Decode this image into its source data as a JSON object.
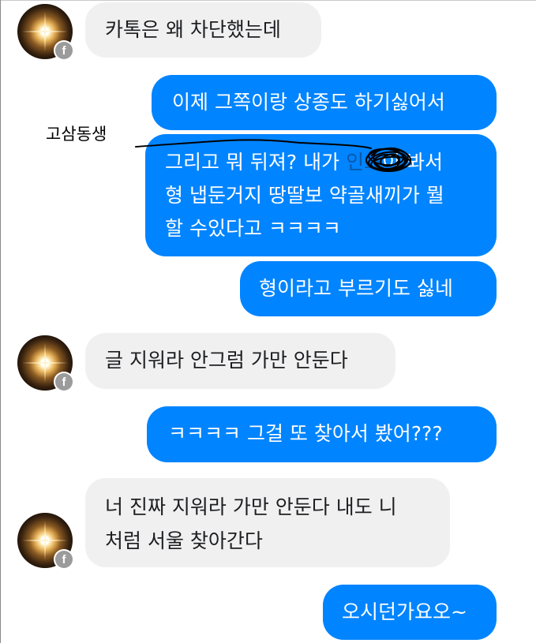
{
  "messages": [
    {
      "side": "in",
      "text": "카톡은 왜 차단했는데"
    },
    {
      "side": "out",
      "text": "이제 그쪽이랑 상종도 하기싫어서"
    },
    {
      "side": "out",
      "line1": "그리고 뭐 뒤져? 내가 ",
      "line1_hidden": "인스",
      "line1_tail": "이 봐서",
      "line2": "형 냅둔거지 땅딸보 약골새끼가 뭘",
      "line3": "할 수있다고 ㅋㅋㅋㅋ"
    },
    {
      "side": "out",
      "text": "형이라고 부르기도 싫네"
    },
    {
      "side": "in",
      "text": "글 지워라 안그럼 가만 안둔다"
    },
    {
      "side": "out",
      "text": "ㅋㅋㅋㅋ 그걸 또 찾아서 봤어???"
    },
    {
      "side": "in",
      "line1": "너 진짜 지워라 가만 안둔다 내도 니",
      "line2": "처럼 서울 찾아간다"
    },
    {
      "side": "out",
      "text": "오시던가요오~"
    }
  ],
  "annotation": {
    "label": "고삼동생"
  },
  "badge": {
    "letter": "f"
  },
  "colors": {
    "outgoing": "#0084ff",
    "incoming": "#f1f0f0",
    "incoming_text": "#1c1e21",
    "badge": "#9b9b9b"
  },
  "icons": {
    "badge": "facebook-icon",
    "avatar": "profile-photo"
  }
}
